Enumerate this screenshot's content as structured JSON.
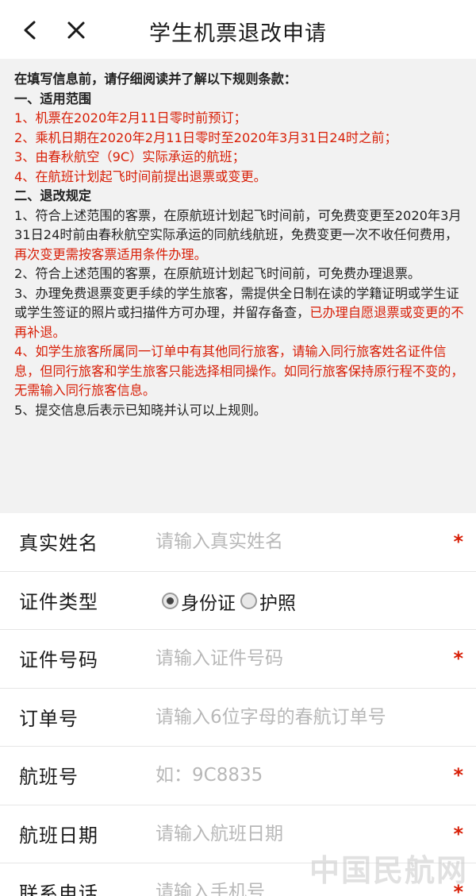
{
  "header": {
    "title": "学生机票退改申请",
    "back_icon": "chevron-left-icon",
    "close_icon": "close-icon"
  },
  "rules": {
    "intro": "在填写信息前，请仔细阅读并了解以下规则条款：",
    "section1_title": "一、适用范围",
    "scope": [
      "1、机票在2020年2月11日零时前预订；",
      "2、乘机日期在2020年2月11日零时至2020年3月31日24时之前；",
      "3、由春秋航空（9C）实际承运的航班；",
      "4、在航班计划起飞时间前提出退票或变更。"
    ],
    "section2_title": "二、退改规定",
    "item1_normal": "1、符合上述范围的客票，在原航班计划起飞时间前，可免费变更至2020年3月31日24时前由春秋航空实际承运的同航线航班，免费变更一次不收任何费用，",
    "item1_red": "再次变更需按客票适用条件办理。",
    "item2": "2、符合上述范围的客票，在原航班计划起飞时间前，可免费办理退票。",
    "item3_normal": "3、办理免费退票变更手续的学生旅客，需提供全日制在读的学籍证明或学生证或学生签证的照片或扫描件方可办理，并留存备查，",
    "item3_red": "已办理自愿退票或变更的不再补退。",
    "item4": "4、如学生旅客所属同一订单中有其他同行旅客，请输入同行旅客姓名证件信息，但同行旅客和学生旅客只能选择相同操作。如同行旅客保持原行程不变的，无需输入同行旅客信息。",
    "item5": "5、提交信息后表示已知晓并认可以上规则。"
  },
  "form": {
    "name_label": "真实姓名",
    "name_placeholder": "请输入真实姓名",
    "id_type_label": "证件类型",
    "id_type_options": [
      "身份证",
      "护照"
    ],
    "id_type_selected": "身份证",
    "id_number_label": "证件号码",
    "id_number_placeholder": "请输入证件号码",
    "order_label": "订单号",
    "order_placeholder": "请输入6位字母的春航订单号",
    "flight_label": "航班号",
    "flight_placeholder": "如：9C8835",
    "date_label": "航班日期",
    "date_placeholder": "请输入航班日期",
    "phone_label": "联系电话",
    "phone_placeholder": "请输入手机号",
    "required_mark": "*"
  },
  "watermark": "中国民航网",
  "colors": {
    "accent_red": "#d81e06",
    "rules_bg": "#f2f2f2",
    "placeholder": "#b8b8b8"
  }
}
